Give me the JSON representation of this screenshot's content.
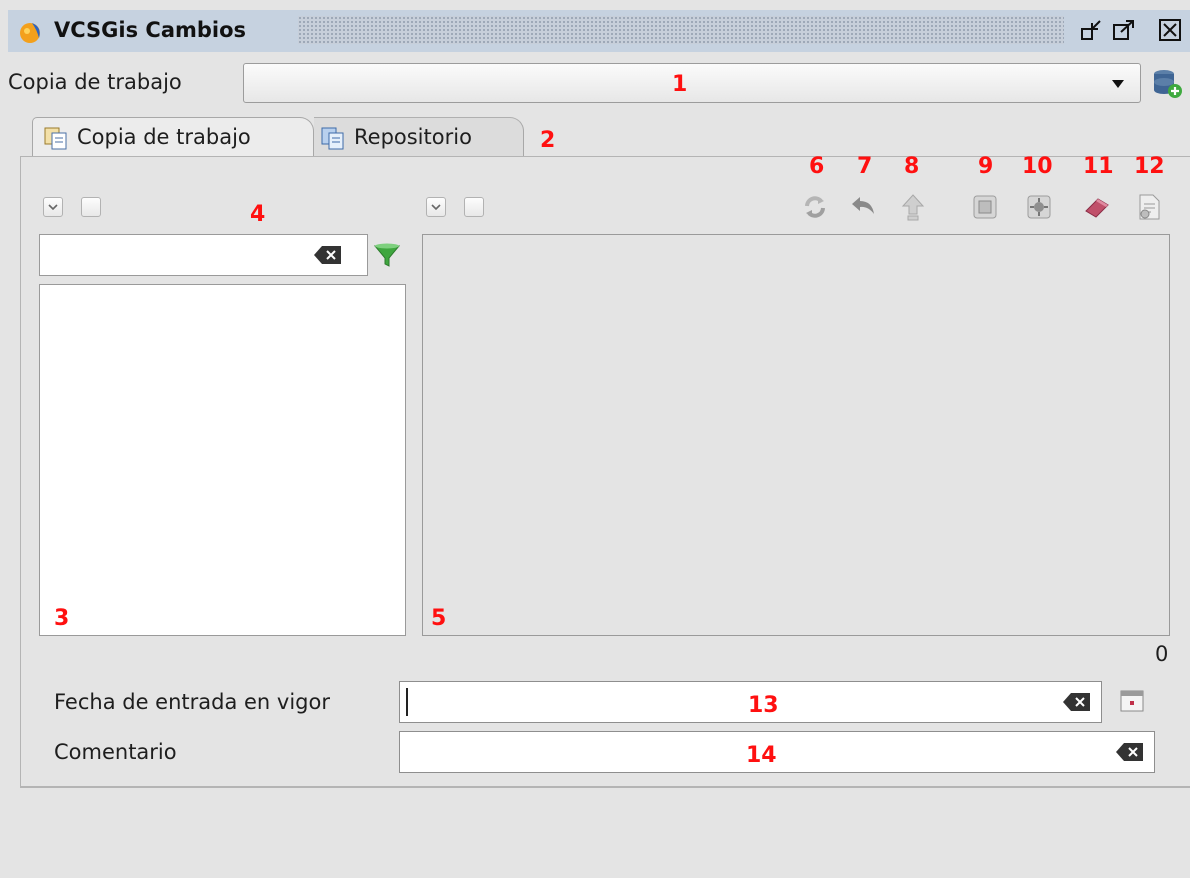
{
  "window": {
    "title": "VCSGis Cambios",
    "icons": [
      "app-icon",
      "minimize-icon",
      "maximize-icon",
      "close-icon"
    ]
  },
  "working_copy": {
    "label": "Copia de trabajo",
    "selected_value": "",
    "annotation": "1",
    "add_icon": "database-add-icon"
  },
  "tabs": [
    {
      "label": "Copia de trabajo",
      "icon": "working-copy-tab-icon",
      "selected": true
    },
    {
      "label": "Repositorio",
      "icon": "repository-tab-icon",
      "selected": false
    }
  ],
  "tabs_annotation": "2",
  "left_panel": {
    "filter_value": "",
    "filter_annotation": "4",
    "list_annotation": "3",
    "icons": [
      "select-all-icon",
      "deselect-icon",
      "clear-icon",
      "filter-icon"
    ]
  },
  "right_panel": {
    "annotation": "5",
    "count": "0",
    "toolbar": [
      {
        "annotation": "6",
        "icon": "refresh-icon"
      },
      {
        "annotation": "7",
        "icon": "revert-icon"
      },
      {
        "annotation": "8",
        "icon": "commit-icon"
      },
      {
        "annotation": "9",
        "icon": "zoom-to-selection-icon"
      },
      {
        "annotation": "10",
        "icon": "center-on-selection-icon"
      },
      {
        "annotation": "11",
        "icon": "eraser-icon"
      },
      {
        "annotation": "12",
        "icon": "report-icon"
      }
    ]
  },
  "effective_date": {
    "label": "Fecha de entrada en vigor",
    "value": "",
    "annotation": "13",
    "calendar_icon": "calendar-icon"
  },
  "comment": {
    "label": "Comentario",
    "value": "",
    "annotation": "14"
  },
  "colors": {
    "annotation": "#ff1010",
    "titlebar": "#c6d2e0",
    "background": "#e4e4e4",
    "filter_green": "#3fa63f",
    "eraser": "#c0506a"
  }
}
